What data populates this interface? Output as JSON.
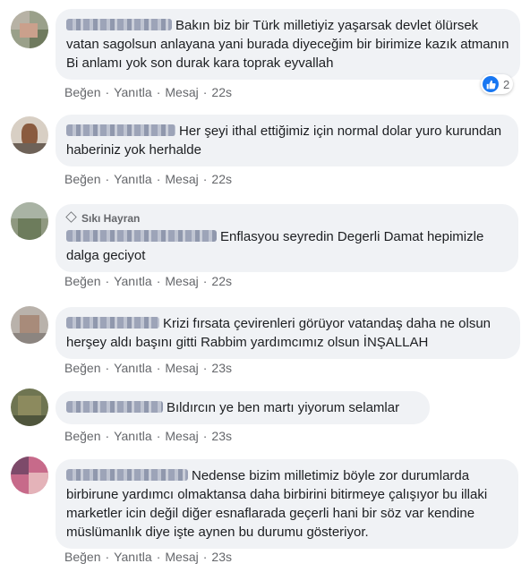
{
  "comments": [
    {
      "badge": "",
      "text": "Bakın biz bir Türk milletiyiz yaşarsak devlet ölürsek vatan sagolsun anlayana yani burada diyeceğim bir birimize kazık atmanın Bi anlamı yok son durak kara toprak eyvallah",
      "like": "Beğen",
      "reply": "Yanıtla",
      "message": "Mesaj",
      "time": "22s",
      "reactions": "2"
    },
    {
      "badge": "",
      "text": "Her şeyi ithal ettiğimiz için normal dolar yuro kurundan haberiniz yok herhalde",
      "like": "Beğen",
      "reply": "Yanıtla",
      "message": "Mesaj",
      "time": "22s"
    },
    {
      "badge": "Sıkı Hayran",
      "text": "Enflasyou seyredin Degerli Damat hepimizle dalga geciyot",
      "like": "Beğen",
      "reply": "Yanıtla",
      "message": "Mesaj",
      "time": "22s"
    },
    {
      "badge": "",
      "text": "Krizi fırsata çevirenleri görüyor vatandaş daha ne olsun herşey aldı başını gitti Rabbim yardımcımız olsun İNŞALLAH",
      "like": "Beğen",
      "reply": "Yanıtla",
      "message": "Mesaj",
      "time": "23s"
    },
    {
      "badge": "",
      "text": "Bıldırcın ye ben martı yiyorum selamlar",
      "like": "Beğen",
      "reply": "Yanıtla",
      "message": "Mesaj",
      "time": "23s"
    },
    {
      "badge": "",
      "text": "Nedense bizim milletimiz böyle zor durumlarda birbirune yardımcı olmaktansa daha birbirini bitirmeye çalışıyor bu illaki marketler icin değil diğer esnaflarada geçerli hani bir söz var kendine müslümanlık diye işte aynen bu durumu gösteriyor.",
      "like": "Beğen",
      "reply": "Yanıtla",
      "message": "Mesaj",
      "time": "23s"
    }
  ],
  "icons": {
    "like": "thumbs-up-icon",
    "badge": "diamond-icon"
  },
  "colors": {
    "bubble": "#f0f2f5",
    "like_blue": "#1877f2",
    "meta_gray": "#65676b"
  }
}
